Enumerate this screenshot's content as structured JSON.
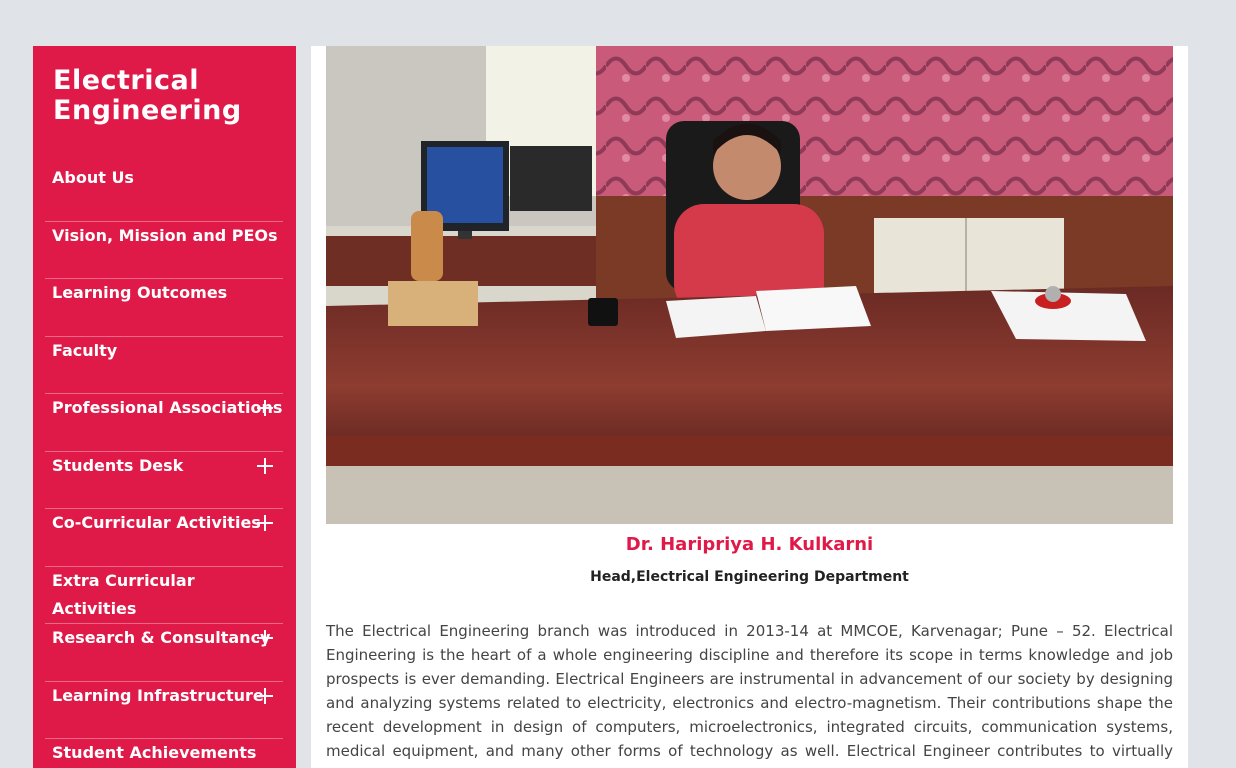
{
  "sidebar": {
    "title": "Electrical Engineering",
    "items": [
      {
        "label": "About Us",
        "expandable": false
      },
      {
        "label": "Vision, Mission and PEOs",
        "expandable": false
      },
      {
        "label": "Learning Outcomes",
        "expandable": false
      },
      {
        "label": "Faculty",
        "expandable": false
      },
      {
        "label": "Professional Associations",
        "expandable": true
      },
      {
        "label": "Students Desk",
        "expandable": true
      },
      {
        "label": "Co-Curricular Activities",
        "expandable": true
      },
      {
        "label": "Extra Curricular Activities",
        "expandable": false
      },
      {
        "label": "Research & Consultancy",
        "expandable": true
      },
      {
        "label": "Learning Infrastructure",
        "expandable": true
      },
      {
        "label": "Student Achievements",
        "expandable": false
      }
    ]
  },
  "profile": {
    "name": "Dr. Haripriya H. Kulkarni",
    "role": "Head,Electrical Engineering Department"
  },
  "description": "The Electrical Engineering branch was introduced in 2013-14 at MMCOE, Karvenagar; Pune – 52. Electrical Engineering is the heart of a whole engineering discipline and therefore its scope in terms knowledge and job prospects is ever demanding. Electrical Engineers are instrumental in advancement of our society by designing and analyzing systems related to electricity, electronics and electro-magnetism. Their contributions shape the recent development in design of computers, microelectronics, integrated circuits, communication systems, medical equipment, and many other forms of technology as well. Electrical Engineer contributes to virtually every product or the manufacturing process.",
  "colors": {
    "accent": "#e01a48",
    "background": "#e0e4e8"
  }
}
